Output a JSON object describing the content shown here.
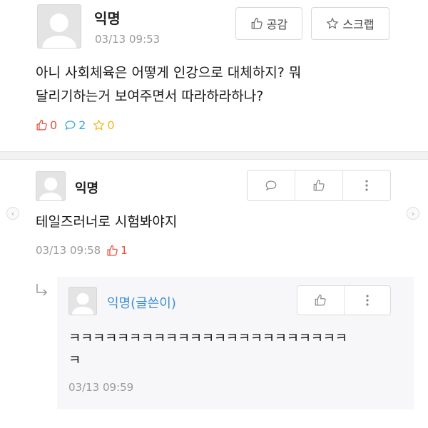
{
  "post": {
    "author": "익명",
    "timestamp": "03/13 09:53",
    "empathy_label": "공감",
    "scrap_label": "스크랩",
    "body_line1": "아니 사회체육은 어떻게 인강으로 대체하지? 뭐",
    "body_line2": "달리기하는거 보여주면서 따라하라하나?",
    "like_count": "0",
    "comment_count": "2",
    "scrap_count": "0"
  },
  "comment": {
    "author": "익명",
    "text": "테일즈러너로 시험봐야지",
    "timestamp": "03/13 09:58",
    "like_count": "1"
  },
  "reply": {
    "author": "익명(글쓴이)",
    "text_line1": "ㅋㅋㅋㅋㅋㅋㅋㅋㅋㅋㅋㅋㅋㅋㅋㅋㅋㅋㅋㅋㅋㅋㅋ",
    "text_line2": "ㅋ",
    "timestamp": "03/13 09:59"
  },
  "colors": {
    "like": "#e0533d",
    "comment": "#3aa6d8",
    "scrap": "#f2b81c",
    "author_reply": "#3d8fd6"
  },
  "icons": [
    "thumbs-up-icon",
    "star-icon",
    "speech-bubble-icon",
    "more-vertical-icon",
    "reply-arrow-icon",
    "chevron-left-icon",
    "chevron-right-icon"
  ]
}
